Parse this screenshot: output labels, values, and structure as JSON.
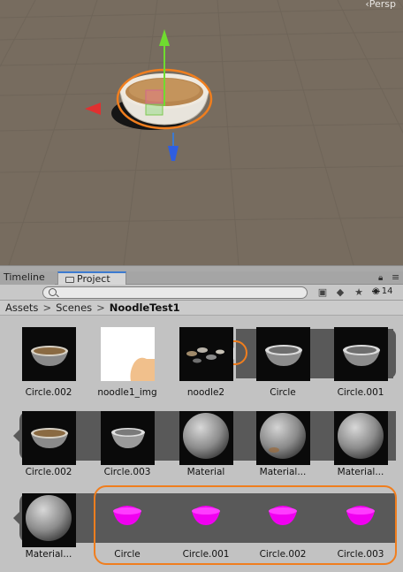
{
  "scene": {
    "camera_mode": "‹Persp"
  },
  "tabs": {
    "timeline": "Timeline",
    "project": "Project"
  },
  "toolbar": {
    "search_placeholder": "",
    "filter_count": "14",
    "icons": [
      "create-icon",
      "label-icon",
      "star-icon",
      "eye-icon"
    ]
  },
  "breadcrumb": {
    "items": [
      "Assets",
      "Scenes"
    ],
    "current": "NoodleTest1",
    "separator": ">"
  },
  "assets": {
    "row1": [
      "Circle.002",
      "noodle1_img",
      "noodle2",
      "Circle",
      "Circle.001"
    ],
    "row2": [
      "Circle.002",
      "Circle.003",
      "Material",
      "Material...",
      "Material..."
    ],
    "row3": [
      "Material...",
      "Circle",
      "Circle.001",
      "Circle.002",
      "Circle.003"
    ]
  },
  "colors": {
    "scene_bg": "#776c5f",
    "highlight": "#f07e1e",
    "selected_strip": "#595959",
    "missing_shader_magenta": "#f000f0",
    "tab_accent": "#3c7ad0"
  }
}
